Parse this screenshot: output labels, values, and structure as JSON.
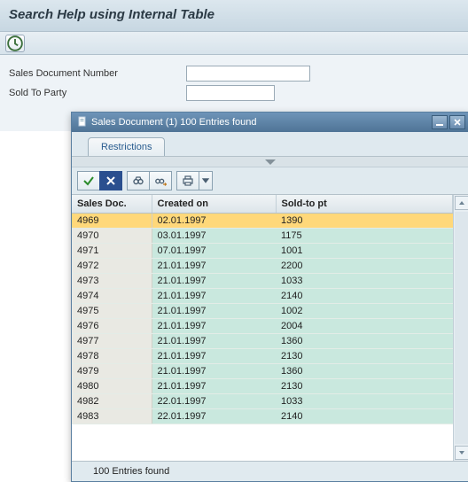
{
  "header": {
    "title": "Search Help using Internal Table"
  },
  "form": {
    "docnum_label": "Sales Document Number",
    "docnum_value": "",
    "soldto_label": "Sold To Party",
    "soldto_value": ""
  },
  "dialog": {
    "title": "Sales Document (1)  100 Entries found",
    "tab": "Restrictions",
    "status": "100 Entries found",
    "columns": {
      "c1": "Sales Doc.",
      "c2": "Created on",
      "c3": "Sold-to pt"
    },
    "rows": [
      {
        "doc": "4969",
        "date": "02.01.1997",
        "soldto": "1390",
        "selected": true
      },
      {
        "doc": "4970",
        "date": "03.01.1997",
        "soldto": "1175"
      },
      {
        "doc": "4971",
        "date": "07.01.1997",
        "soldto": "1001"
      },
      {
        "doc": "4972",
        "date": "21.01.1997",
        "soldto": "2200"
      },
      {
        "doc": "4973",
        "date": "21.01.1997",
        "soldto": "1033"
      },
      {
        "doc": "4974",
        "date": "21.01.1997",
        "soldto": "2140"
      },
      {
        "doc": "4975",
        "date": "21.01.1997",
        "soldto": "1002"
      },
      {
        "doc": "4976",
        "date": "21.01.1997",
        "soldto": "2004"
      },
      {
        "doc": "4977",
        "date": "21.01.1997",
        "soldto": "1360"
      },
      {
        "doc": "4978",
        "date": "21.01.1997",
        "soldto": "2130"
      },
      {
        "doc": "4979",
        "date": "21.01.1997",
        "soldto": "1360"
      },
      {
        "doc": "4980",
        "date": "21.01.1997",
        "soldto": "2130"
      },
      {
        "doc": "4982",
        "date": "22.01.1997",
        "soldto": "1033"
      },
      {
        "doc": "4983",
        "date": "22.01.1997",
        "soldto": "2140"
      }
    ]
  }
}
